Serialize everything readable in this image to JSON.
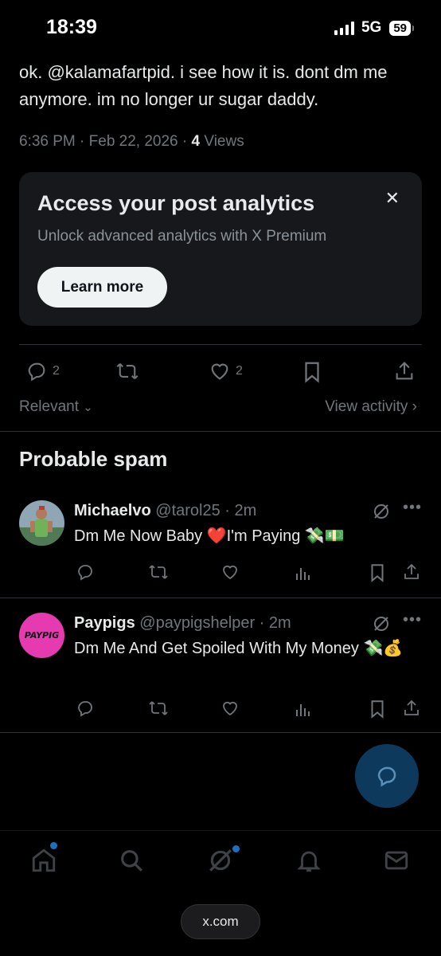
{
  "status_bar": {
    "time": "18:39",
    "network": "5G",
    "battery": "59"
  },
  "post": {
    "text": "ok. @kalamafartpid. i see how it is. dont dm me anymore. im no longer ur sugar daddy.",
    "timestamp": "6:36 PM · Feb 22, 2026 · ",
    "views_count": "4",
    "views_label": " Views"
  },
  "analytics_card": {
    "title": "Access your post analytics",
    "subtitle": "Unlock advanced analytics with X Premium",
    "button": "Learn more",
    "close": "✕"
  },
  "actions": {
    "replies": "2",
    "likes": "2"
  },
  "sort": {
    "label": "Relevant",
    "view_activity": "View activity"
  },
  "spam_section": {
    "title": "Probable spam"
  },
  "replies": [
    {
      "name": "Michaelvo",
      "handle": "@tarol25 · 2m",
      "text": "Dm Me Now Baby ❤️I'm Paying 💸💵"
    },
    {
      "name": "Paypigs",
      "handle": "@paypigshelper · 2m",
      "text": "Dm Me And Get Spoiled With My Money 💸💰",
      "avatar_text": "PAYPIG"
    }
  ],
  "browser": {
    "url": "x.com"
  },
  "colors": {
    "accent": "#1d9bf0",
    "muted": "#71767b",
    "card_bg": "#16181c"
  }
}
